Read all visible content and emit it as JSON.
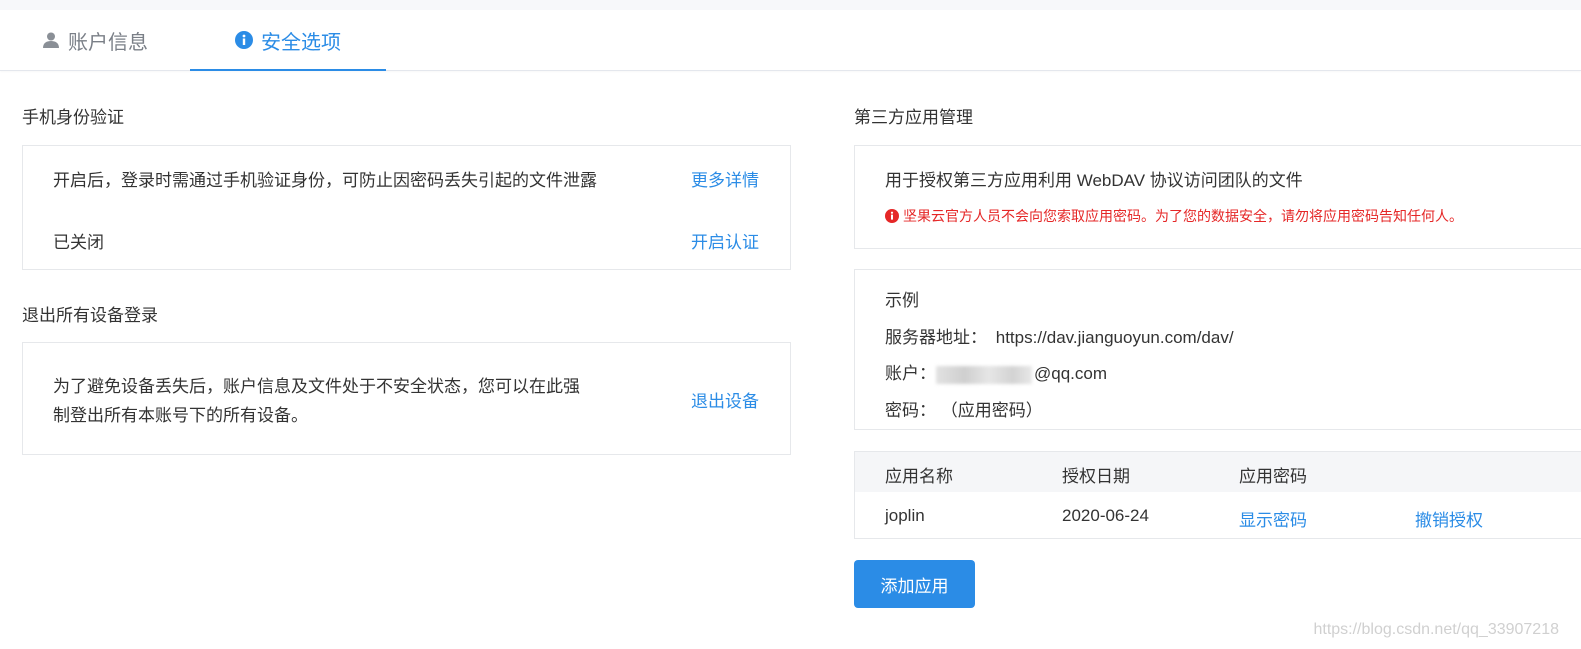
{
  "tabs": [
    {
      "label": "账户信息",
      "icon": "user-icon",
      "active": false
    },
    {
      "label": "安全选项",
      "icon": "info-icon",
      "active": true
    }
  ],
  "colors": {
    "primary": "#2b8ce6",
    "warning": "#e52727",
    "border": "#e6e8eb",
    "table_header_bg": "#f5f6f8"
  },
  "phone_auth": {
    "title": "手机身份验证",
    "description": "开启后，登录时需通过手机验证身份，可防止因密码丢失引起的文件泄露",
    "more_link": "更多详情",
    "status": "已关闭",
    "enable_link": "开启认证"
  },
  "logout_devices": {
    "title": "退出所有设备登录",
    "description_line1": "为了避免设备丢失后，账户信息及文件处于不安全状态，您可以在此强",
    "description_line2": "制登出所有本账号下的所有设备。",
    "logout_link": "退出设备"
  },
  "third_party": {
    "title": "第三方应用管理",
    "description": "用于授权第三方应用利用 WebDAV 协议访问团队的文件",
    "warning": "坚果云官方人员不会向您索取应用密码。为了您的数据安全，请勿将应用密码告知任何人。",
    "example": {
      "heading": "示例",
      "server_label": "服务器地址：",
      "server_value": "https://dav.jianguoyun.com/dav/",
      "account_label": "账户：",
      "account_value": "@qq.com",
      "password_label": "密码：",
      "password_value": "（应用密码）"
    },
    "table": {
      "headers": [
        "应用名称",
        "授权日期",
        "应用密码"
      ],
      "rows": [
        {
          "name": "joplin",
          "date": "2020-06-24",
          "show_password": "显示密码",
          "revoke": "撤销授权"
        }
      ]
    },
    "add_button": "添加应用"
  },
  "watermark": "https://blog.csdn.net/qq_33907218"
}
